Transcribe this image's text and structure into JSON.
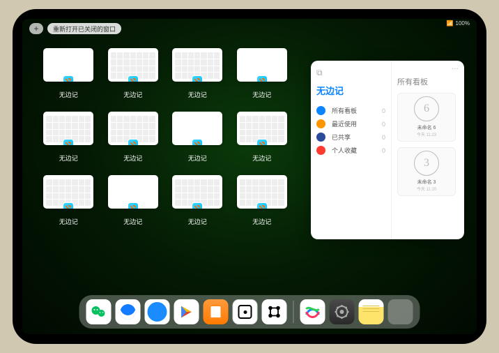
{
  "statusbar": {
    "wifi": "📶",
    "battery": "100%"
  },
  "topbar": {
    "plus": "+",
    "reopen": "重新打开已关闭的窗口"
  },
  "app_label": "无边记",
  "thumbs": [
    {
      "style": "blank"
    },
    {
      "style": "cal"
    },
    {
      "style": "cal2"
    },
    {
      "style": "blank"
    },
    {
      "style": "cal"
    },
    {
      "style": "cal2"
    },
    {
      "style": "blank"
    },
    {
      "style": "cal"
    },
    {
      "style": "cal2"
    },
    {
      "style": "blank"
    },
    {
      "style": "cal"
    },
    {
      "style": "cal2"
    }
  ],
  "panel": {
    "title": "无边记",
    "icon_top": "⧉",
    "items": [
      {
        "color": "blue",
        "label": "所有看板",
        "count": "0"
      },
      {
        "color": "orange",
        "label": "最近使用",
        "count": "0"
      },
      {
        "color": "navy",
        "label": "已共享",
        "count": "0"
      },
      {
        "color": "red",
        "label": "个人收藏",
        "count": "0"
      }
    ],
    "right_title": "所有看板",
    "more": "···",
    "cards": [
      {
        "sketch": "6",
        "name": "未命名 6",
        "time": "今天 11:23"
      },
      {
        "sketch": "3",
        "name": "未命名 3",
        "time": "今天 11:20"
      }
    ]
  },
  "dock": [
    {
      "id": "wechat",
      "name": "WeChat"
    },
    {
      "id": "qq",
      "name": "QQ"
    },
    {
      "id": "browser",
      "name": "QQ Browser"
    },
    {
      "id": "play",
      "name": "Play"
    },
    {
      "id": "books",
      "name": "Books"
    },
    {
      "id": "dice",
      "name": "Game"
    },
    {
      "id": "connect",
      "name": "Connect"
    },
    {
      "id": "sep"
    },
    {
      "id": "freeform",
      "name": "Freeform"
    },
    {
      "id": "settings",
      "name": "Settings"
    },
    {
      "id": "notes",
      "name": "Notes"
    },
    {
      "id": "folder",
      "name": "App Folder"
    }
  ]
}
